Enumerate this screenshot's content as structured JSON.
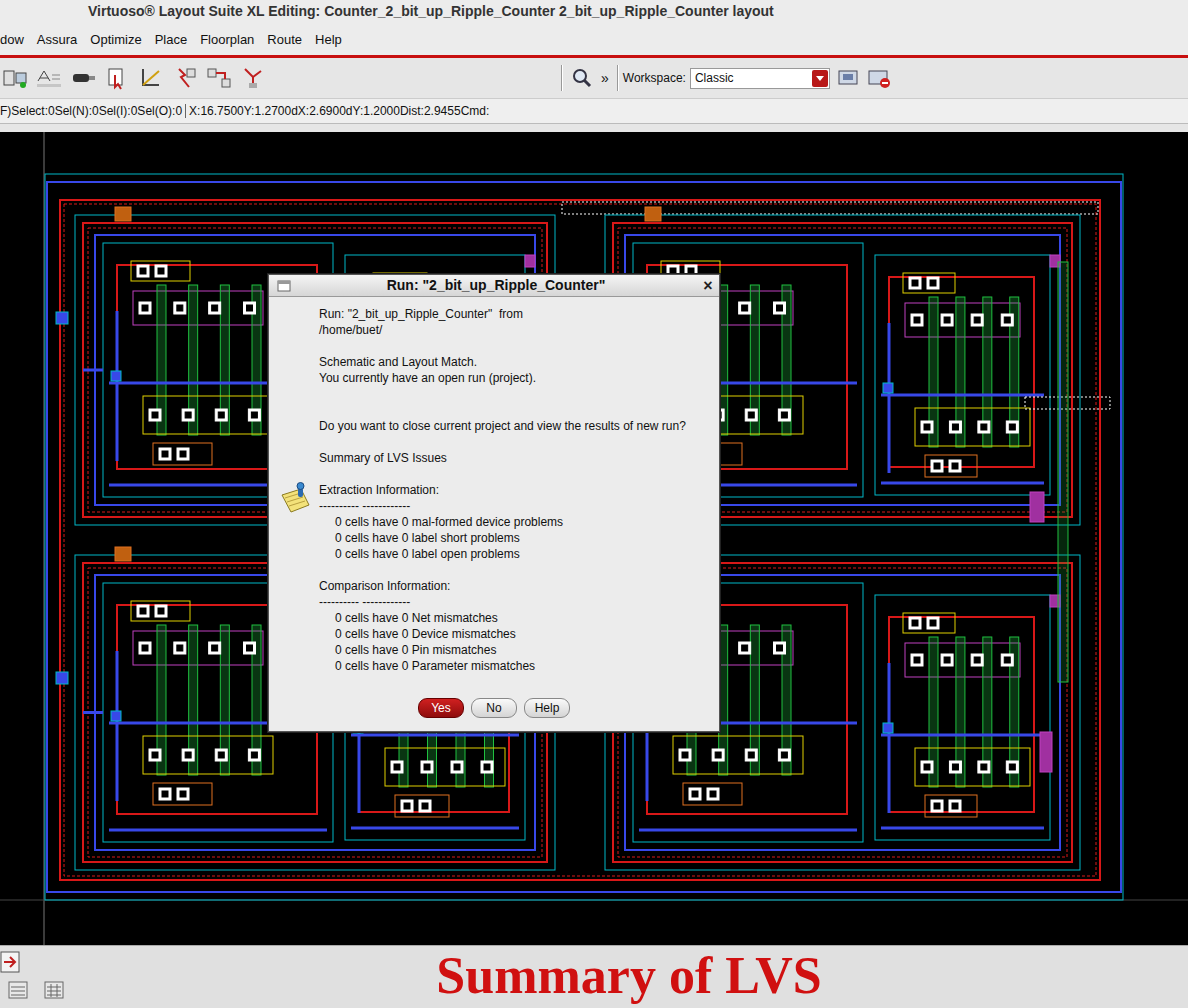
{
  "window": {
    "title": "Virtuoso® Layout Suite XL Editing: Counter_2_bit_up_Ripple_Counter 2_bit_up_Ripple_Counter layout"
  },
  "menu": [
    "dow",
    "Assura",
    "Optimize",
    "Place",
    "Floorplan",
    "Route",
    "Help"
  ],
  "toolbar": {
    "more": "»",
    "workspace_label": "Workspace:",
    "workspace": "Classic"
  },
  "status_line": {
    "selection": "F)Select:0Sel(N):0Sel(I):0Sel(O):0",
    "coords": "X:16.7500Y:1.2700dX:2.6900dY:1.2000Dist:2.9455Cmd:"
  },
  "dialog": {
    "title": "Run: \"2_bit_up_Ripple_Counter\"",
    "close": "×",
    "intro": [
      [
        "Run: \"2_bit_up_Ripple_Counter\"  from",
        "/home/buet/"
      ],
      [
        "Schematic and Layout Match.",
        "You currently have an open run (project)."
      ],
      [
        "Do you want to close current project and view the results of new run?"
      ],
      [
        "Summary of LVS Issues"
      ]
    ],
    "sections": [
      {
        "title": "Extraction Information:",
        "rule": "---------- ------------",
        "items": [
          "0 cells have 0 mal-formed device problems",
          "0 cells have 0 label short problems",
          "0 cells have 0 label open problems"
        ]
      },
      {
        "title": "Comparison Information:",
        "rule": "---------- ------------",
        "items": [
          "0 cells have 0 Net mismatches",
          "0 cells have 0 Device mismatches",
          "0 cells have 0 Pin mismatches",
          "0 cells have 0 Parameter mismatches"
        ]
      }
    ],
    "buttons": [
      {
        "label": "Yes",
        "default": true
      },
      {
        "label": "No",
        "default": false
      },
      {
        "label": "Help",
        "default": false
      }
    ]
  },
  "caption": "Summary of LVS"
}
